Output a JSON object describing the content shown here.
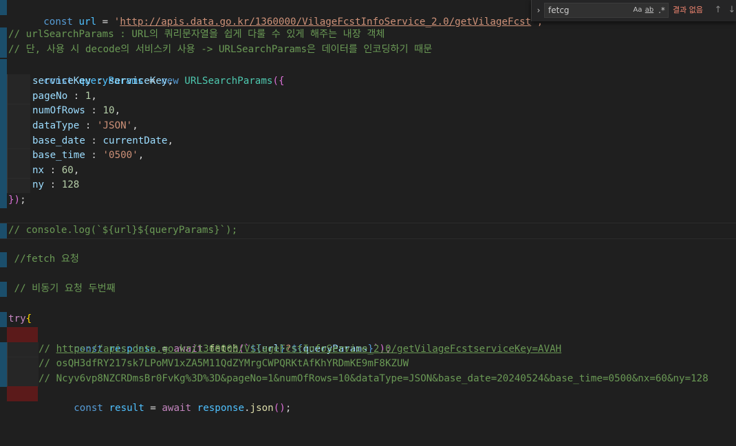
{
  "find": {
    "query": "fetcg",
    "match_case": "Aa",
    "whole_word": "ab",
    "regex": ".*",
    "status": "결과 없음",
    "toggle_icon": "chevron-right-icon",
    "prev_icon": "arrow-up-icon",
    "next_icon": "arrow-down-icon"
  },
  "code": {
    "l1": {
      "kw": "const",
      "var": "url",
      "op": " = ",
      "q1": "'",
      "url": "http://apis.data.go.kr/1360000/VilageFcstInfoService_2.0/getVilageFcst",
      "q2": "';"
    },
    "l3": "// urlSearchParams : URL의 쿼리문자열을 쉽게 다룰 수 있게 해주는 내장 객체",
    "l4": "// 단, 사용 시 decode의 서비스키 사용 -> URLSearchParams은 데이터를 인코딩하기 때문",
    "l5": {
      "kw": "const",
      "var": "queryParams",
      "op": " = ",
      "new": "new",
      "cls": "URLSearchParams",
      "open": "({"
    },
    "params": [
      {
        "key": "serviceKey",
        "sep": " : ",
        "val": "serviceKey",
        "type": "var",
        "end": ","
      },
      {
        "key": "pageNo",
        "sep": " : ",
        "val": "1",
        "type": "num",
        "end": ","
      },
      {
        "key": "numOfRows",
        "sep": " : ",
        "val": "10",
        "type": "num",
        "end": ","
      },
      {
        "key": "dataType",
        "sep": " : ",
        "val": "'JSON'",
        "type": "str",
        "end": ","
      },
      {
        "key": "base_date",
        "sep": " : ",
        "val": "currentDate",
        "type": "var",
        "end": ","
      },
      {
        "key": "base_time",
        "sep": " : ",
        "val": "'0500'",
        "type": "str",
        "end": ","
      },
      {
        "key": "nx",
        "sep": " : ",
        "val": "60",
        "type": "num",
        "end": ","
      },
      {
        "key": "ny",
        "sep": " : ",
        "val": "128",
        "type": "num",
        "end": ""
      }
    ],
    "l14": {
      "close": "})",
      "semi": ";"
    },
    "l16": "// console.log(`${url}${queryParams}`);",
    "l18": " //fetch 요청",
    "l20": " // 비동기 요청 두번째",
    "l22": {
      "kw": "try",
      "open": "{"
    },
    "l23": {
      "kw": "const",
      "var": "response",
      "op": " = ",
      "await": "await",
      "fn": "fetch",
      "p1": "(`",
      "t1": "${",
      "v1": "url",
      "t2": "}",
      "mid": "?",
      "t3": "${",
      "v2": "queryParams",
      "t4": "}",
      "p2": "`);"
    },
    "l24": {
      "pre": "// ",
      "link": "https://apis.data.go.kr/1360000/VilageFcstInfoService_2.0/getVilageFcstserviceKey=AVAH"
    },
    "l25": "// osQH3dfRY217sk7LPoMV1xZA5M11QdZYMrgCWPQRKtAfKhYRDmKE9mF8KZUW",
    "l26": "// Ncyv6vp8NZCRDmsBr0FvKg%3D%3D&pageNo=1&numOfRows=10&dataType=JSON&base_date=20240524&base_time=0500&nx=60&ny=128",
    "l27": {
      "kw": "const",
      "var": "result",
      "op": " = ",
      "await": "await",
      "obj": "response",
      "dot": ".",
      "fn": "json",
      "call": "()",
      "semi": ";"
    }
  }
}
